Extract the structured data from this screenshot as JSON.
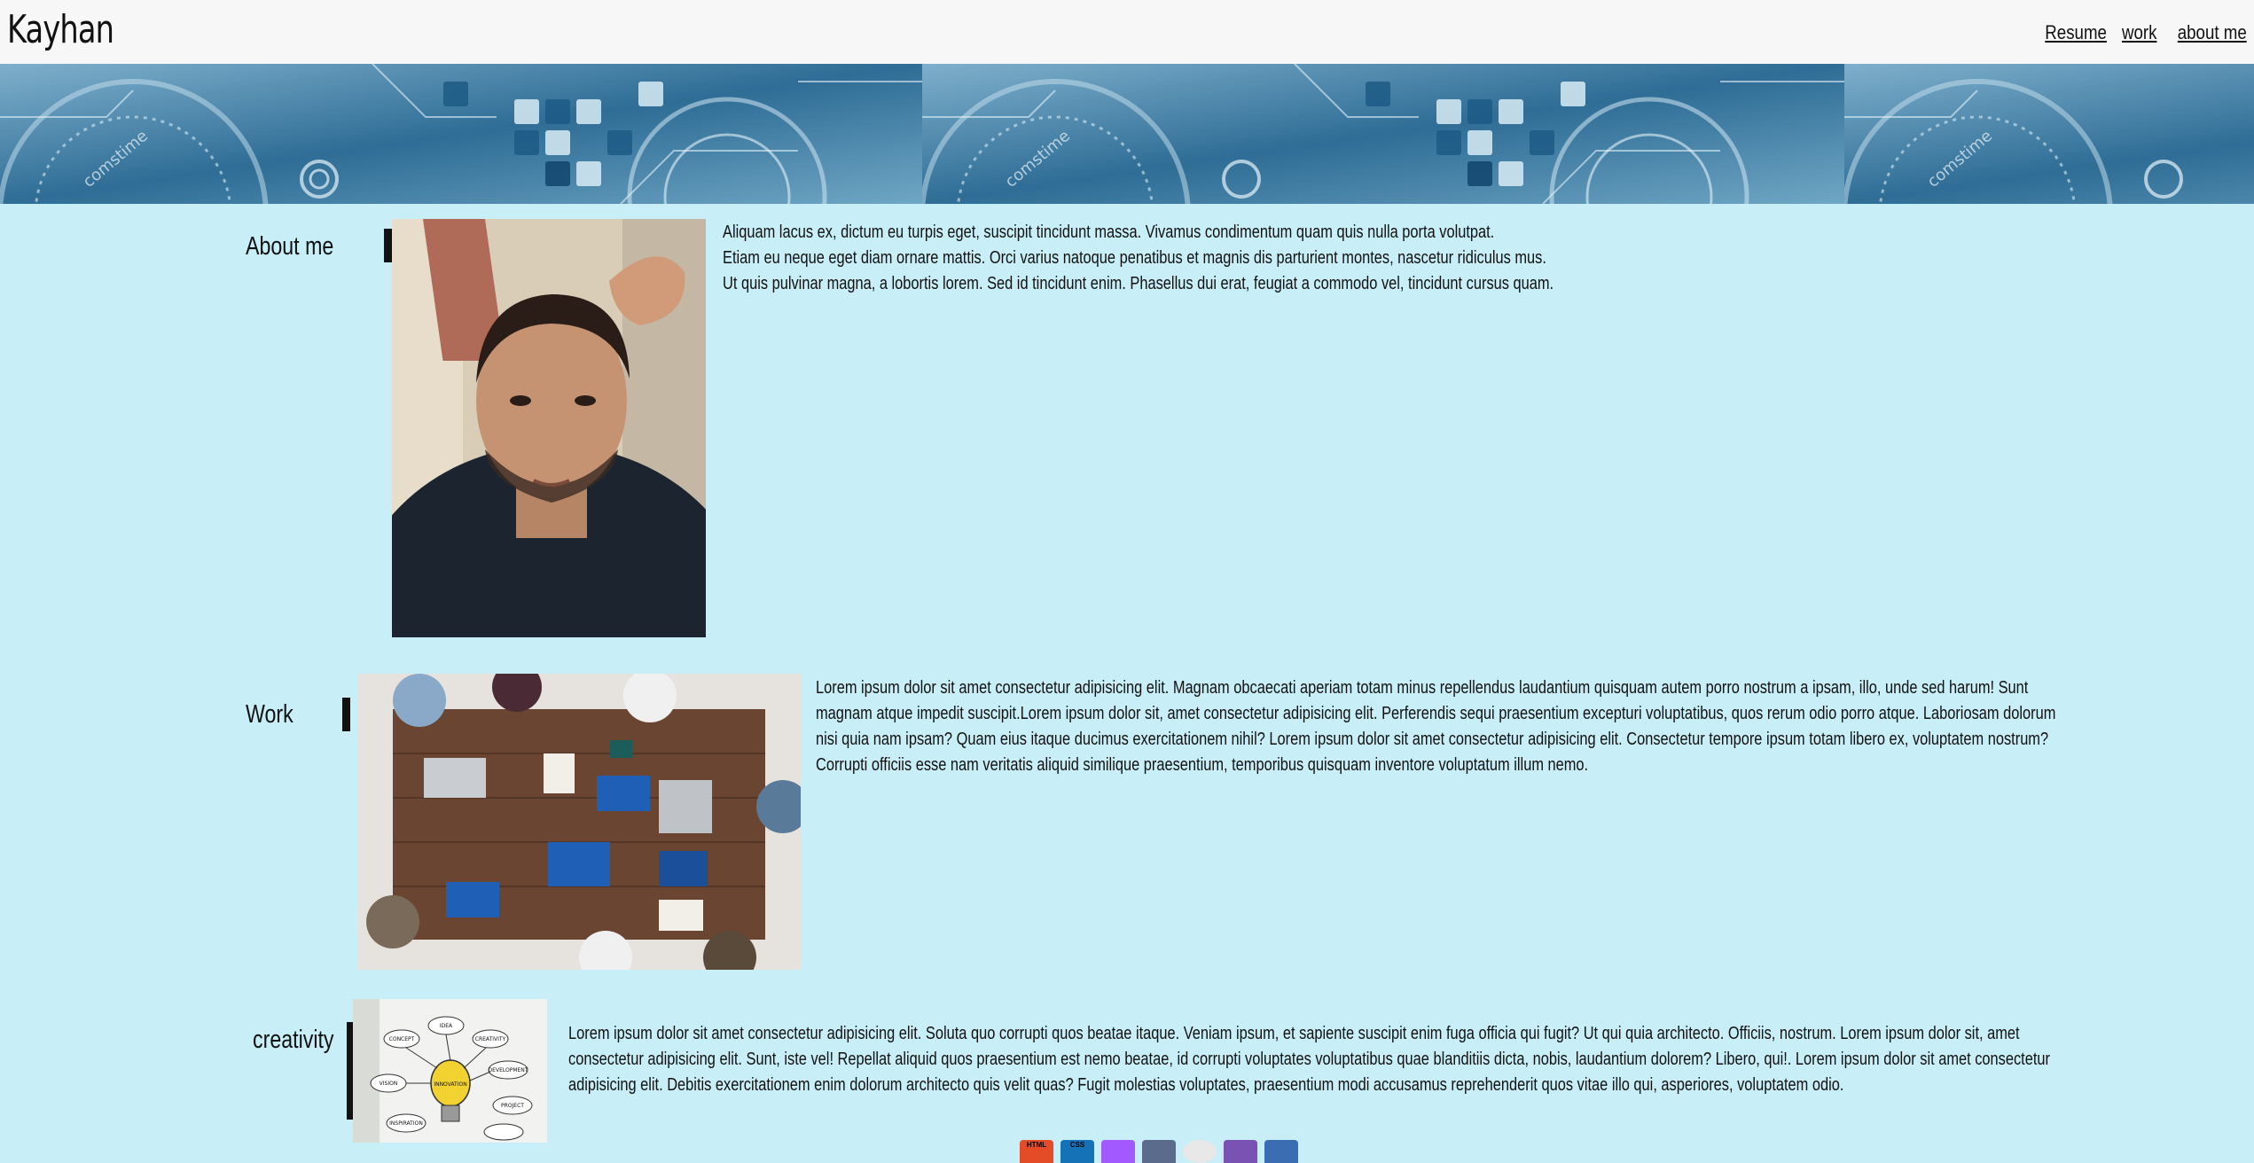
{
  "header": {
    "brand": "Kayhan",
    "nav": [
      "Resume",
      "work",
      "about me"
    ]
  },
  "banner": {
    "watermark": "comstime"
  },
  "sections": [
    {
      "label": "About me",
      "paragraph_lines": [
        "Aliquam lacus ex, dictum eu turpis eget, suscipit tincidunt massa. Vivamus condimentum quam quis nulla porta volutpat.",
        "Etiam eu neque eget diam ornare mattis. Orci varius natoque penatibus et magnis dis parturient montes, nascetur ridiculus mus.",
        "Ut quis pulvinar magna, a lobortis lorem. Sed id tincidunt enim. Phasellus dui erat, feugiat a commodo vel, tincidunt cursus quam."
      ]
    },
    {
      "label": "Work",
      "paragraph": "Lorem ipsum dolor sit amet consectetur adipisicing elit. Magnam obcaecati aperiam totam minus repellendus laudantium quisquam autem porro nostrum a ipsam, illo, unde sed harum! Sunt magnam atque impedit suscipit.Lorem ipsum dolor sit, amet consectetur adipisicing elit. Perferendis sequi praesentium excepturi voluptatibus, quos rerum odio porro atque. Laboriosam dolorum nisi quia nam ipsam? Quam eius itaque ducimus exercitationem nihil? Lorem ipsum dolor sit amet consectetur adipisicing elit. Consectetur tempore ipsum totam libero ex, voluptatem nostrum? Corrupti officiis esse nam veritatis aliquid similique praesentium, temporibus quisquam inventore voluptatum illum nemo."
    },
    {
      "label": "creativity",
      "paragraph": "Lorem ipsum dolor sit amet consectetur adipisicing elit. Soluta quo corrupti quos beatae itaque. Veniam ipsum, et sapiente suscipit enim fuga officia qui fugit? Ut qui quia architecto. Officiis, nostrum. Lorem ipsum dolor sit, amet consectetur adipisicing elit. Sunt, iste vel! Repellat aliquid quos praesentium est nemo beatae, id corrupti voluptates voluptatibus quae blanditiis dicta, nobis, laudantium dolorem? Libero, qui!. Lorem ipsum dolor sit amet consectetur adipisicing elit. Debitis exercitationem enim dolorum architecto quis velit quas? Fugit molestias voluptates, praesentium modi accusamus reprehenderit quos vitae illo qui, asperiores, voluptatem odio.",
      "diagram_words": [
        "IDEA",
        "CONCEPT",
        "INNOVATION",
        "VISION",
        "DEVELOPMENT",
        "CREATIVITY",
        "INSPIRATION",
        "PROJECT"
      ]
    }
  ],
  "tech_icons": [
    {
      "name": "HTML",
      "color": "#e34c26"
    },
    {
      "name": "CSS",
      "color": "#1572b6"
    },
    {
      "name": "",
      "color": "#a259ff"
    },
    {
      "name": "",
      "color": "#5b6b8c"
    },
    {
      "name": "",
      "color": "#e8e8e8"
    },
    {
      "name": "",
      "color": "#7952b3"
    },
    {
      "name": "",
      "color": "#3b6db3"
    }
  ]
}
